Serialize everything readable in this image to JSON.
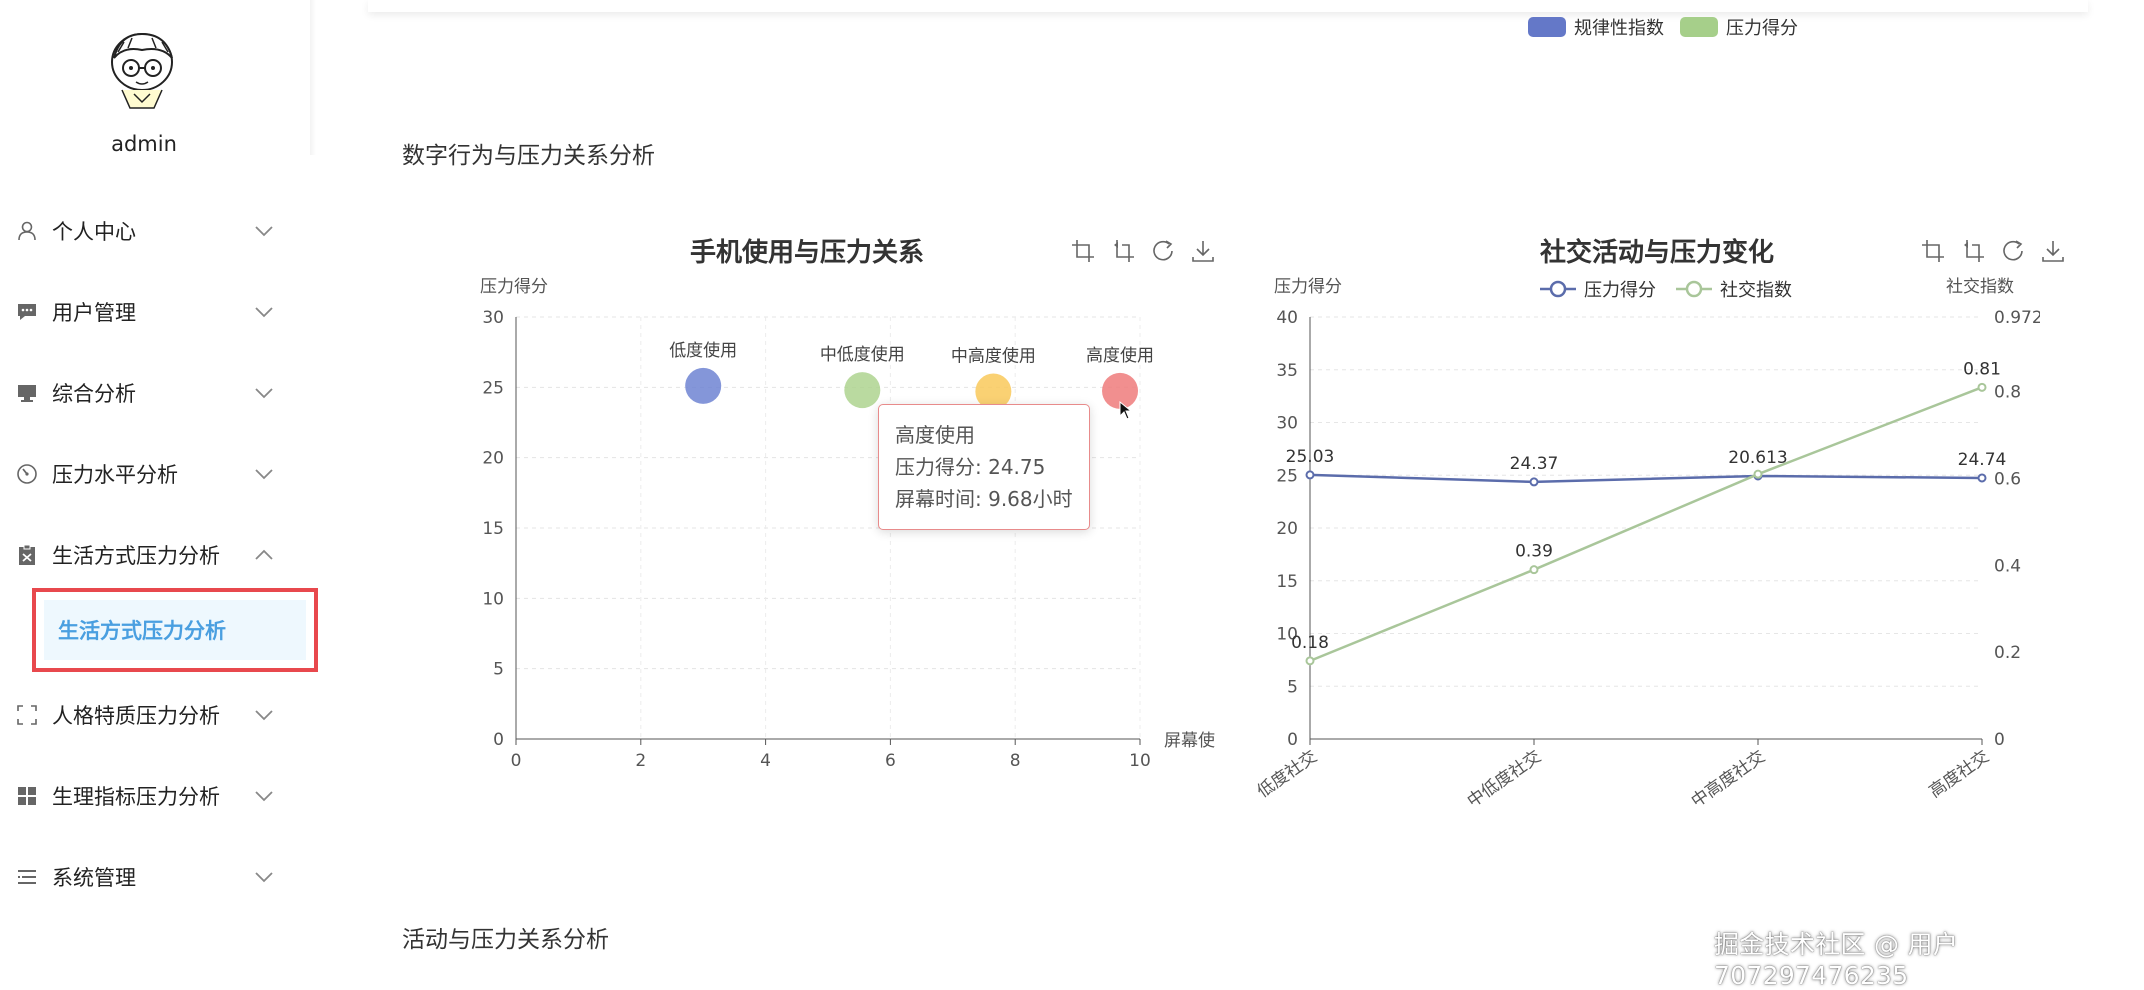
{
  "user": {
    "name": "admin"
  },
  "menu": [
    {
      "label": "个人中心",
      "icon": "user-icon",
      "expanded": false
    },
    {
      "label": "用户管理",
      "icon": "message-icon",
      "expanded": false
    },
    {
      "label": "综合分析",
      "icon": "monitor-icon",
      "expanded": false
    },
    {
      "label": "压力水平分析",
      "icon": "gauge-icon",
      "expanded": false
    },
    {
      "label": "生活方式压力分析",
      "icon": "clipboard-icon",
      "expanded": true
    },
    {
      "label": "人格特质压力分析",
      "icon": "fullscreen-icon",
      "expanded": false
    },
    {
      "label": "生理指标压力分析",
      "icon": "grid-icon",
      "expanded": false
    },
    {
      "label": "系统管理",
      "icon": "list-icon",
      "expanded": false
    }
  ],
  "submenu": {
    "active_label": "生活方式压力分析"
  },
  "top_chart": {
    "legend": [
      {
        "name": "规律性指数",
        "color": "#6478c8"
      },
      {
        "name": "压力得分",
        "color": "#a6cf8a"
      }
    ]
  },
  "sections": {
    "digital": "数字行为与压力关系分析",
    "activity": "活动与压力关系分析"
  },
  "tooltip": {
    "title": "高度使用",
    "line1": "压力得分: 24.75",
    "line2": "屏幕时间: 9.68小时"
  },
  "watermark": "掘金技术社区 @ 用户707297476235",
  "chart_data": [
    {
      "type": "scatter",
      "title": "手机使用与压力关系",
      "ylabel": "压力得分",
      "xlabel": "屏幕使",
      "xlim": [
        0,
        10
      ],
      "ylim": [
        0,
        30
      ],
      "x_ticks": [
        0,
        2,
        4,
        6,
        8,
        10
      ],
      "y_ticks": [
        0,
        5,
        10,
        15,
        20,
        25,
        30
      ],
      "points": [
        {
          "label": "低度使用",
          "x": 3.0,
          "y": 25.1,
          "color": "#6e84d2"
        },
        {
          "label": "中低度使用",
          "x": 5.55,
          "y": 24.8,
          "color": "#aed38f"
        },
        {
          "label": "中高度使用",
          "x": 7.65,
          "y": 24.7,
          "color": "#f9c95b"
        },
        {
          "label": "高度使用",
          "x": 9.68,
          "y": 24.75,
          "color": "#ef7b7b"
        }
      ]
    },
    {
      "type": "line",
      "title": "社交活动与压力变化",
      "categories": [
        "低度社交",
        "中低度社交",
        "中高度社交",
        "高度社交"
      ],
      "ylabel": "压力得分",
      "y2label": "社交指数",
      "ylim": [
        0,
        40
      ],
      "y2lim": [
        0,
        0.972
      ],
      "y_ticks": [
        0,
        5,
        10,
        15,
        20,
        25,
        30,
        35,
        40
      ],
      "y2_ticks": [
        "0",
        "0.2",
        "0.4",
        "0.6",
        "0.8",
        "0.972"
      ],
      "series": [
        {
          "name": "压力得分",
          "axis": "left",
          "values": [
            25.03,
            24.37,
            24.93,
            24.74
          ],
          "labels": [
            "25.03",
            "24.37",
            "",
            "24.74"
          ],
          "color": "#5b6cab"
        },
        {
          "name": "社交指数",
          "axis": "right",
          "values": [
            0.18,
            0.39,
            0.61,
            0.81
          ],
          "labels": [
            "0.18",
            "0.39",
            "",
            "0.81"
          ],
          "color": "#a9c69a"
        }
      ],
      "overlap_label": "20.613"
    }
  ]
}
